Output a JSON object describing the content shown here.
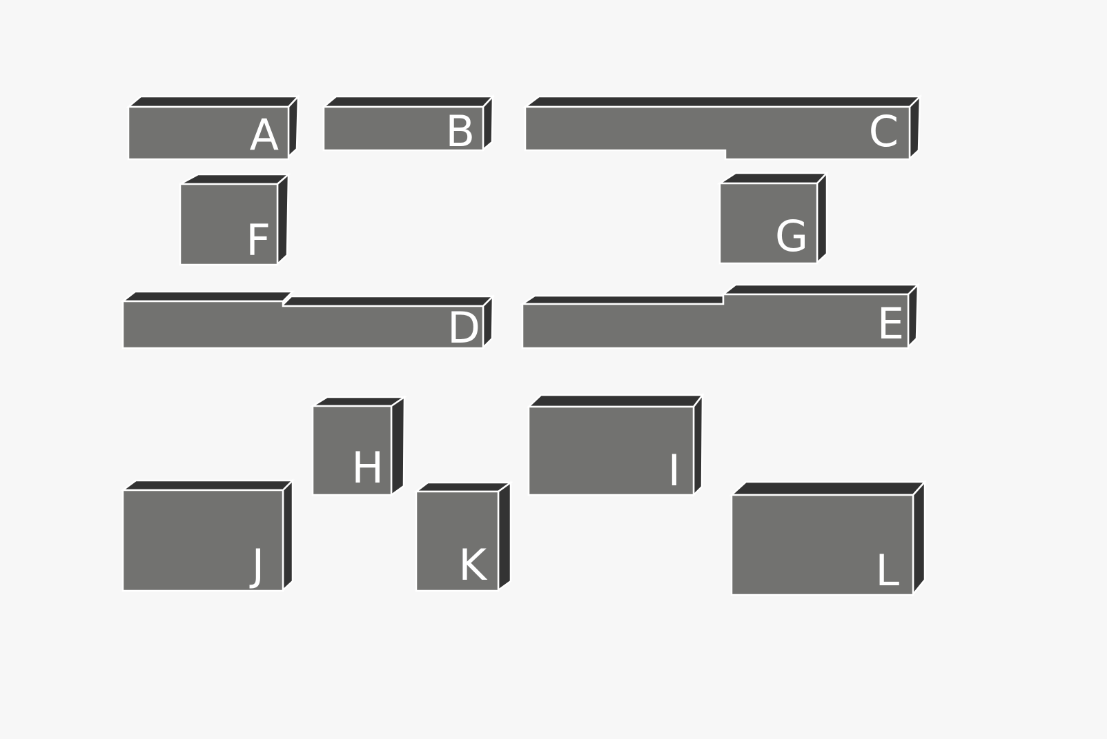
{
  "diagram": {
    "blocks": [
      {
        "id": "A",
        "label": "A"
      },
      {
        "id": "B",
        "label": "B"
      },
      {
        "id": "C",
        "label": "C"
      },
      {
        "id": "D",
        "label": "D"
      },
      {
        "id": "E",
        "label": "E"
      },
      {
        "id": "F",
        "label": "F"
      },
      {
        "id": "G",
        "label": "G"
      },
      {
        "id": "H",
        "label": "H"
      },
      {
        "id": "I",
        "label": "I"
      },
      {
        "id": "J",
        "label": "J"
      },
      {
        "id": "K",
        "label": "K"
      },
      {
        "id": "L",
        "label": "L"
      }
    ]
  },
  "colors": {
    "background": "#f7f7f7",
    "front_face": "#727270",
    "top_side_face": "#333333",
    "outline_and_labels": "#ffffff"
  }
}
